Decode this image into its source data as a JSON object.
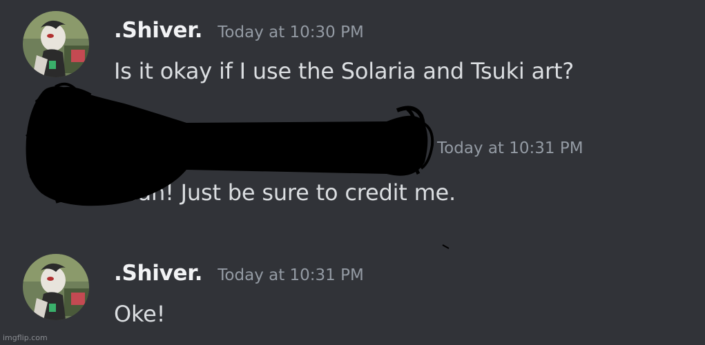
{
  "messages": [
    {
      "author": ".Shiver.",
      "timestamp": "Today at 10:30 PM",
      "text": "Is it okay if I use the Solaria and Tsuki art?"
    },
    {
      "author": "",
      "timestamp": "Today at 10:31 PM",
      "text": "Yeah! Just be sure to credit me."
    },
    {
      "author": ".Shiver.",
      "timestamp": "Today at 10:31 PM",
      "text": "Oke!"
    }
  ],
  "watermark": "imgflip.com",
  "colors": {
    "background": "#313338",
    "username": "#f2f3f5",
    "timestamp": "#949ba4",
    "message_text": "#dbdee1",
    "redaction": "#000000"
  },
  "icons": {
    "avatar": "avatar-image",
    "redaction": "redaction-scribble"
  }
}
